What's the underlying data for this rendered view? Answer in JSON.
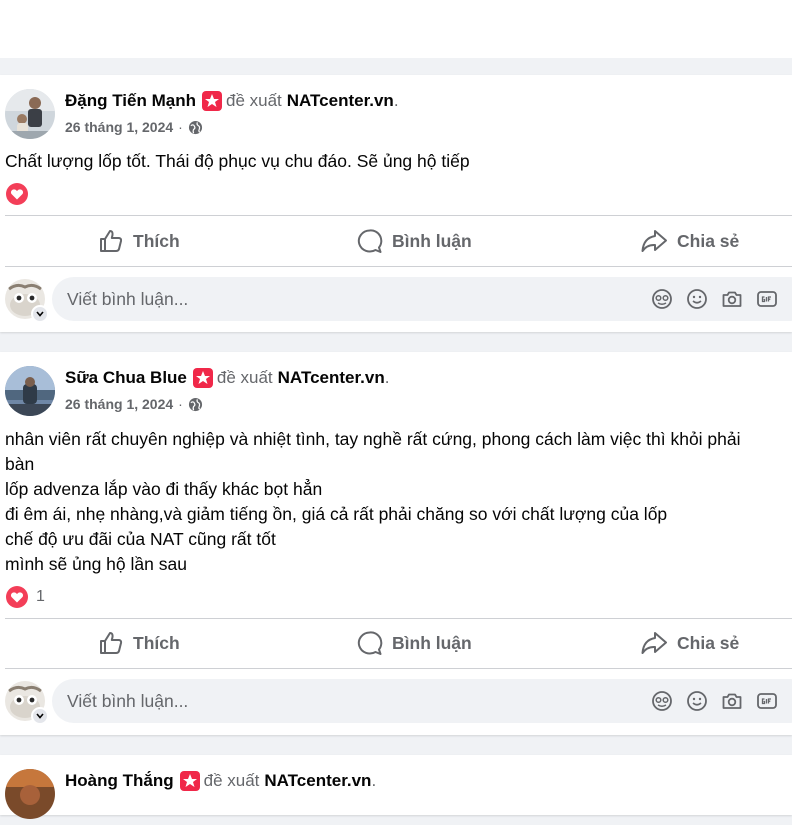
{
  "posts": [
    {
      "author": "Đặng Tiến Mạnh",
      "recommends": "đề xuất",
      "page": "NATcenter.vn",
      "period": ".",
      "date": "26 tháng 1, 2024",
      "separator": "·",
      "text_lines": [
        "Chất lượng lốp tốt. Thái độ phục vụ chu đáo. Sẽ ủng hộ tiếp"
      ],
      "reaction_count": ""
    },
    {
      "author": "Sữa Chua Blue",
      "recommends": "đề xuất",
      "page": "NATcenter.vn",
      "period": ".",
      "date": "26 tháng 1, 2024",
      "separator": "·",
      "text_lines": [
        "nhân viên rất chuyên nghiệp và nhiệt tình, tay nghề rất cứng, phong cách làm việc thì khỏi phải",
        "bàn",
        "lốp advenza lắp vào đi thấy khác bọt hẳn",
        "đi êm ái, nhẹ nhàng,và giảm tiếng ồn, giá cả rất phải chăng so với chất lượng của lốp",
        "chế độ ưu đãi của NAT cũng rất tốt",
        "mình sẽ ủng hộ lần sau"
      ],
      "reaction_count": "1"
    },
    {
      "author": "Hoàng Thắng",
      "recommends": "đề xuất",
      "page": "NATcenter.vn",
      "period": "."
    }
  ],
  "actions": {
    "like": "Thích",
    "comment": "Bình luận",
    "share": "Chia sẻ"
  },
  "comment": {
    "placeholder": "Viết bình luận..."
  },
  "icons": {
    "recommend": "star-badge-icon",
    "privacy": "globe-icon",
    "like": "thumbs-up-icon",
    "comment": "comment-bubble-icon",
    "share": "share-arrow-icon",
    "avatar_sticker": "avatar-sticker-icon",
    "emoji": "emoji-icon",
    "camera": "camera-icon",
    "gif": "gif-icon"
  },
  "colors": {
    "badge": "#f02849",
    "heart": "#f33e58",
    "muted": "#65676b",
    "text": "#050505"
  }
}
